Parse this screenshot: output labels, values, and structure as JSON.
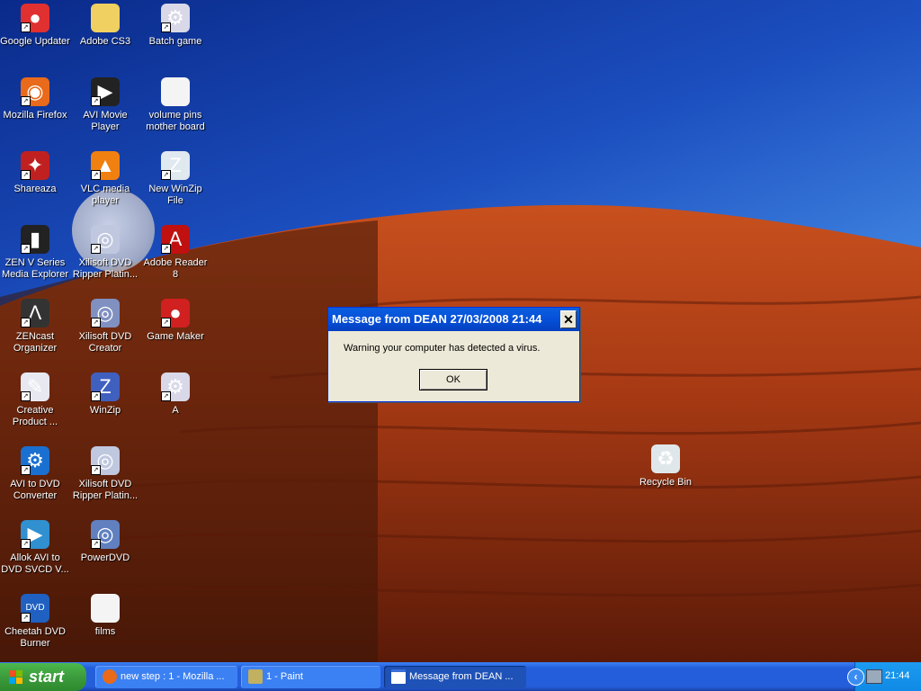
{
  "desktop": {
    "icons": [
      {
        "label": "Google Updater",
        "icon": "google-updater-icon",
        "color": "#e03030",
        "glyph": "●"
      },
      {
        "label": "Adobe CS3",
        "icon": "folder-icon",
        "color": "#f0d060",
        "glyph": ""
      },
      {
        "label": "Batch game",
        "icon": "application-window-icon",
        "color": "#d8d8e8",
        "glyph": "⚙"
      },
      {
        "label": "Mozilla Firefox",
        "icon": "firefox-icon",
        "color": "#e86a1a",
        "glyph": "◉"
      },
      {
        "label": "AVI Movie Player",
        "icon": "clapperboard-icon",
        "color": "#222",
        "glyph": "▶"
      },
      {
        "label": "volume pins mother board",
        "icon": "text-document-icon",
        "color": "#f4f4f4",
        "glyph": ""
      },
      {
        "label": "Shareaza",
        "icon": "shareaza-icon",
        "color": "#c02020",
        "glyph": "✦"
      },
      {
        "label": "VLC media player",
        "icon": "vlc-cone-icon",
        "color": "#f08010",
        "glyph": "▲"
      },
      {
        "label": "New WinZip File",
        "icon": "winzip-file-icon",
        "color": "#e0e8f0",
        "glyph": "Z"
      },
      {
        "label": "ZEN V Series Media Explorer",
        "icon": "mp3-player-icon",
        "color": "#222",
        "glyph": "▮"
      },
      {
        "label": "Xilisoft DVD Ripper Platin...",
        "icon": "dvd-disc-icon",
        "color": "#c0c8e0",
        "glyph": "◎"
      },
      {
        "label": "Adobe Reader 8",
        "icon": "adobe-reader-icon",
        "color": "#c01010",
        "glyph": "A"
      },
      {
        "label": "ZENcast Organizer",
        "icon": "zencast-icon",
        "color": "#333",
        "glyph": "Λ"
      },
      {
        "label": "Xilisoft DVD Creator",
        "icon": "dvd-creator-icon",
        "color": "#8090c0",
        "glyph": "◎"
      },
      {
        "label": "Game Maker",
        "icon": "game-maker-icon",
        "color": "#d02020",
        "glyph": "●"
      },
      {
        "label": "Creative Product ...",
        "icon": "creative-product-icon",
        "color": "#e8e8f0",
        "glyph": "✎"
      },
      {
        "label": "WinZip",
        "icon": "winzip-icon",
        "color": "#4060c0",
        "glyph": "Z"
      },
      {
        "label": "A",
        "icon": "application-window-icon",
        "color": "#d8d8e8",
        "glyph": "⚙"
      },
      {
        "label": "AVI to DVD Converter",
        "icon": "gear-converter-icon",
        "color": "#1a70d0",
        "glyph": "⚙"
      },
      {
        "label": "Xilisoft DVD Ripper Platin...",
        "icon": "dvd-ripper-icon",
        "color": "#c0c8e0",
        "glyph": "◎"
      },
      {
        "label": "",
        "icon": "",
        "color": "",
        "glyph": ""
      },
      {
        "label": "Allok AVI to DVD SVCD V...",
        "icon": "allok-converter-icon",
        "color": "#3090d0",
        "glyph": "▶"
      },
      {
        "label": "PowerDVD",
        "icon": "powerdvd-icon",
        "color": "#6080c0",
        "glyph": "◎"
      },
      {
        "label": "",
        "icon": "",
        "color": "",
        "glyph": ""
      },
      {
        "label": "Cheetah DVD Burner",
        "icon": "cheetah-dvd-icon",
        "color": "#2060c0",
        "glyph": "DVD"
      },
      {
        "label": "films",
        "icon": "text-document-icon",
        "color": "#f4f4f4",
        "glyph": ""
      }
    ],
    "recycle_bin": {
      "label": "Recycle Bin",
      "icon": "recycle-bin-icon"
    }
  },
  "dialog": {
    "title": "Message from DEAN 27/03/2008 21:44",
    "message": "Warning your computer has detected a virus.",
    "ok_label": "OK",
    "close_glyph": "✕"
  },
  "taskbar": {
    "start_label": "start",
    "tasks": [
      {
        "label": "new step : 1 - Mozilla ...",
        "icon": "firefox-icon",
        "active": false
      },
      {
        "label": "1 - Paint",
        "icon": "paint-icon",
        "active": false
      },
      {
        "label": "Message from DEAN ...",
        "icon": "window-icon",
        "active": true
      }
    ],
    "tray": {
      "expand_glyph": "‹",
      "clock": "21:44"
    }
  },
  "colors": {
    "titlebar": "#0550d8",
    "taskbar": "#245edb",
    "start": "#3c9b3c",
    "dialog_bg": "#ece9d8"
  }
}
